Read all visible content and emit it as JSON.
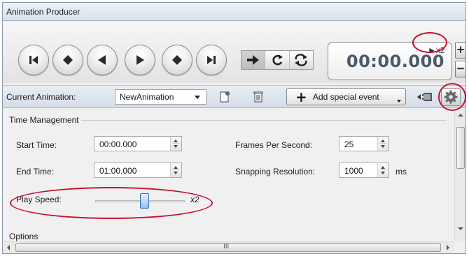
{
  "window": {
    "title": "Animation Producer"
  },
  "transport": {
    "buttons": [
      {
        "name": "go-to-start-button",
        "icon": "skip-to-start-icon"
      },
      {
        "name": "previous-keyframe-button",
        "icon": "previous-keyframe-icon"
      },
      {
        "name": "play-backward-button",
        "icon": "play-backward-icon"
      },
      {
        "name": "play-forward-button",
        "icon": "play-forward-icon"
      },
      {
        "name": "next-keyframe-button",
        "icon": "next-keyframe-icon"
      },
      {
        "name": "go-to-end-button",
        "icon": "skip-to-end-icon"
      }
    ],
    "modes": [
      {
        "name": "play-once-mode",
        "icon": "play-once-icon",
        "active": true
      },
      {
        "name": "loop-mode",
        "icon": "loop-icon",
        "active": false
      },
      {
        "name": "ping-pong-mode",
        "icon": "ping-pong-icon",
        "active": false
      }
    ]
  },
  "time_display": {
    "time": "00:00.000",
    "speed_indicator": "►x2",
    "zoom_in": "+",
    "zoom_out": "−"
  },
  "animation_bar": {
    "label": "Current Animation:",
    "selected_animation": "NewAnimation",
    "new_icon": "new-animation-icon",
    "delete_icon": "trash-icon",
    "special_event_plus": "+",
    "special_event_label": "Add special event",
    "record_icon": "film-strip-icon",
    "settings_icon": "gear-icon"
  },
  "time_management": {
    "group_label": "Time Management",
    "start_time_label": "Start Time:",
    "start_time_value": "00:00.000",
    "end_time_label": "End Time:",
    "end_time_value": "01:00.000",
    "fps_label": "Frames Per Second:",
    "fps_value": "25",
    "snapping_label": "Snapping Resolution:",
    "snapping_value": "1000",
    "snapping_unit": "ms",
    "play_speed_label": "Play Speed:",
    "play_speed_value": "x2",
    "play_speed_level": 0.55
  },
  "options": {
    "group_label": "Options"
  },
  "scrollbar": {
    "middle_grip": "III"
  },
  "colors": {
    "annotation": "#c8102e",
    "title_bar": "#dce5f0",
    "time_text": "#4a5a6a",
    "slider_thumb": "#8ec1ee"
  }
}
